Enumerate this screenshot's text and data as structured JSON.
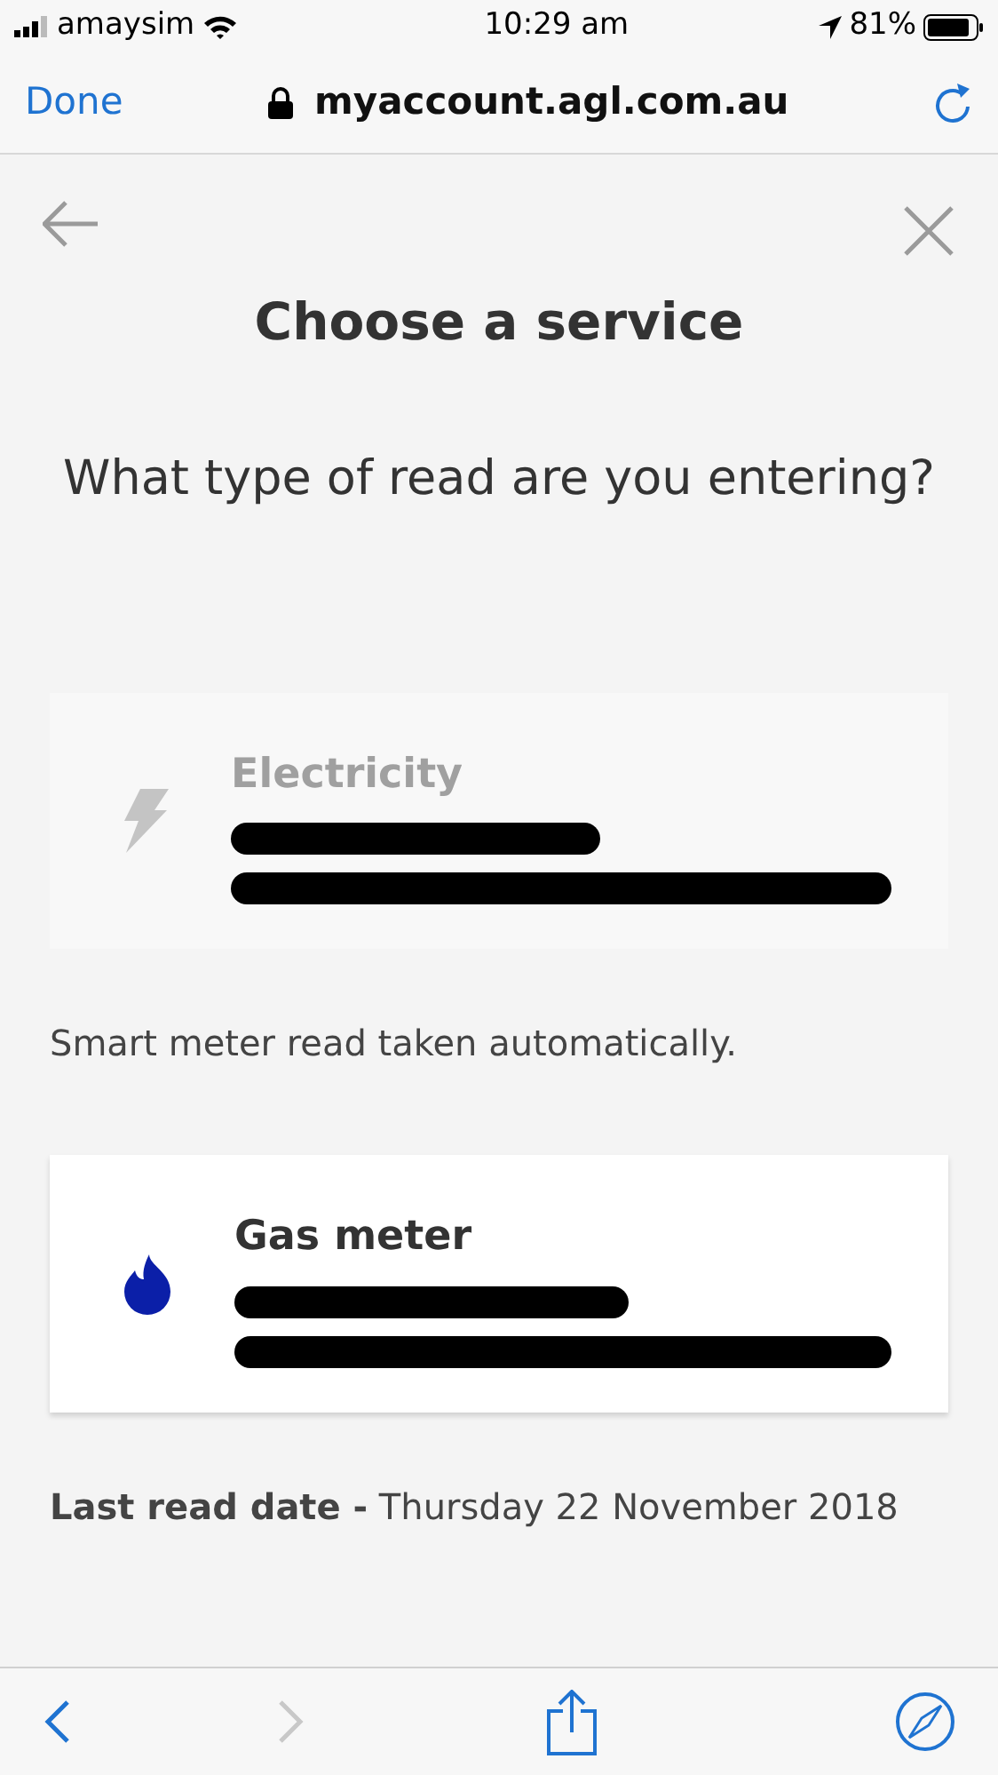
{
  "status_bar": {
    "carrier": "amaysim",
    "time": "10:29 am",
    "battery": "81%"
  },
  "browser": {
    "done": "Done",
    "url": "myaccount.agl.com.au"
  },
  "page": {
    "title": "Choose a service",
    "question": "What type of read are you entering?"
  },
  "services": [
    {
      "kind": "electricity",
      "name": "Electricity",
      "disabled": true,
      "note": "Smart meter read taken automatically."
    },
    {
      "kind": "gas",
      "name": "Gas meter",
      "disabled": false,
      "note": "**Last read date -** Thursday 22 November 2018"
    }
  ],
  "toolbar": {
    "back_disabled": false,
    "forward_disabled": true
  }
}
